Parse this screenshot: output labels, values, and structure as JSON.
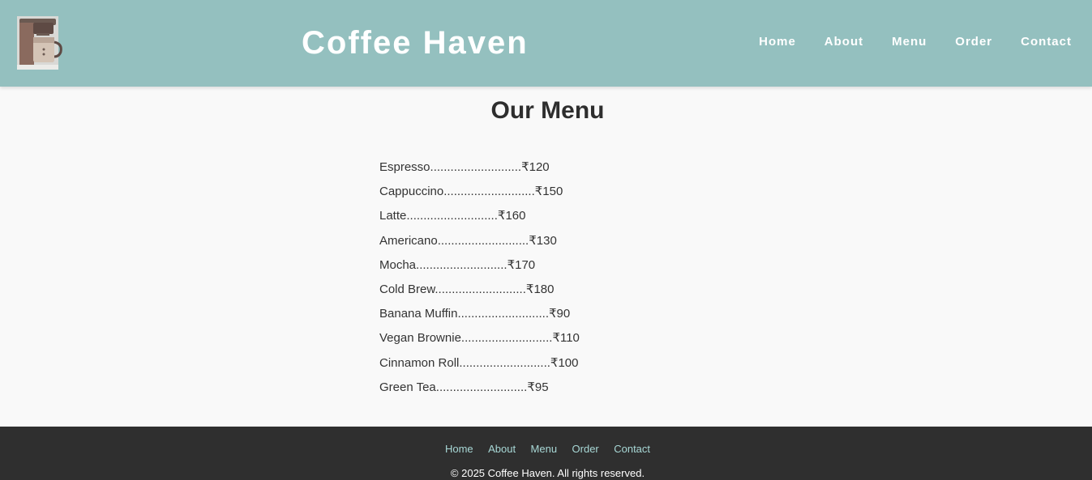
{
  "header": {
    "logo_icon": "coffee-maker-icon",
    "title": "Coffee Haven",
    "nav": [
      {
        "label": "Home"
      },
      {
        "label": "About"
      },
      {
        "label": "Menu"
      },
      {
        "label": "Order"
      },
      {
        "label": "Contact"
      }
    ]
  },
  "main": {
    "heading": "Our Menu",
    "items": [
      {
        "name": "Espresso",
        "dots": "...........................",
        "price": "₹120"
      },
      {
        "name": "Cappuccino",
        "dots": "...........................",
        "price": "₹150"
      },
      {
        "name": "Latte",
        "dots": "...........................",
        "price": "₹160"
      },
      {
        "name": "Americano",
        "dots": "...........................",
        "price": "₹130"
      },
      {
        "name": "Mocha",
        "dots": "...........................",
        "price": "₹170"
      },
      {
        "name": "Cold Brew",
        "dots": "...........................",
        "price": "₹180"
      },
      {
        "name": "Banana Muffin",
        "dots": "...........................",
        "price": "₹90"
      },
      {
        "name": "Vegan Brownie",
        "dots": "...........................",
        "price": "₹110"
      },
      {
        "name": "Cinnamon Roll",
        "dots": "...........................",
        "price": "₹100"
      },
      {
        "name": "Green Tea",
        "dots": "...........................",
        "price": "₹95"
      }
    ]
  },
  "footer": {
    "links": [
      {
        "label": "Home"
      },
      {
        "label": "About"
      },
      {
        "label": "Menu"
      },
      {
        "label": "Order"
      },
      {
        "label": "Contact"
      }
    ],
    "copyright": "© 2025 Coffee Haven. All rights reserved."
  },
  "colors": {
    "header_bg": "#94c0bf",
    "footer_bg": "#2f2f2f",
    "footer_link": "#a8d8d6",
    "page_bg": "#f9f9f9"
  }
}
